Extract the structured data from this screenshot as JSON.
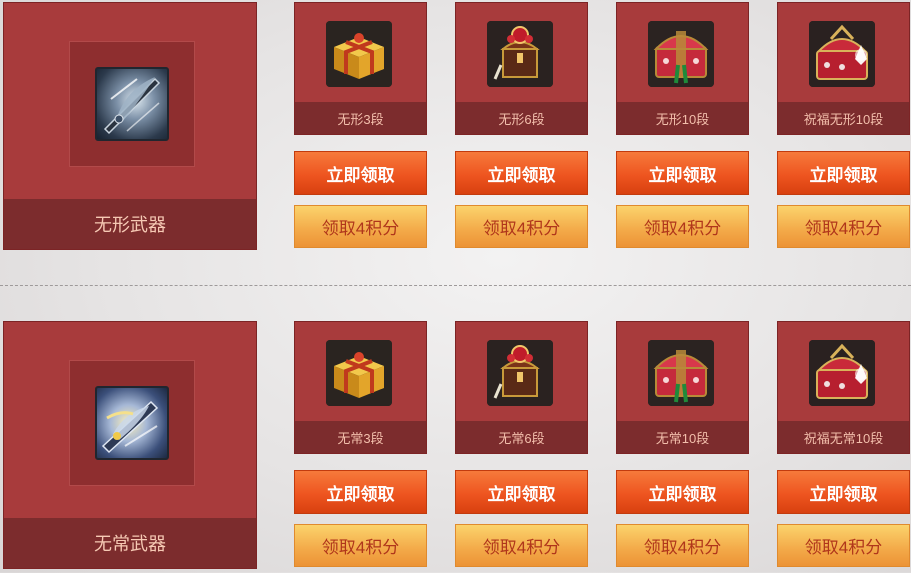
{
  "rows": [
    {
      "weapon": {
        "name": "无形武器",
        "icon": "wuxing-weapon-icon"
      },
      "rewards": [
        {
          "label": "无形3段",
          "icon": "gold-gift-box-icon",
          "claim_label": "立即领取",
          "points_label": "领取4积分"
        },
        {
          "label": "无形6段",
          "icon": "jeweled-box-icon",
          "claim_label": "立即领取",
          "points_label": "领取4积分"
        },
        {
          "label": "无形10段",
          "icon": "red-treasure-chest-icon",
          "claim_label": "立即领取",
          "points_label": "领取4积分"
        },
        {
          "label": "祝福无形10段",
          "icon": "sparkling-chest-icon",
          "claim_label": "立即领取",
          "points_label": "领取4积分"
        }
      ]
    },
    {
      "weapon": {
        "name": "无常武器",
        "icon": "wuchang-weapon-icon"
      },
      "rewards": [
        {
          "label": "无常3段",
          "icon": "gold-gift-box-icon",
          "claim_label": "立即领取",
          "points_label": "领取4积分"
        },
        {
          "label": "无常6段",
          "icon": "jeweled-box-icon",
          "claim_label": "立即领取",
          "points_label": "领取4积分"
        },
        {
          "label": "无常10段",
          "icon": "red-treasure-chest-icon",
          "claim_label": "立即领取",
          "points_label": "领取4积分"
        },
        {
          "label": "祝福无常10段",
          "icon": "sparkling-chest-icon",
          "claim_label": "立即领取",
          "points_label": "领取4积分"
        }
      ]
    }
  ],
  "colors": {
    "card": "#a83b3c",
    "label_band": "#7c2c2d",
    "claim_button": "#ee5520",
    "points_button": "#f3a948"
  }
}
